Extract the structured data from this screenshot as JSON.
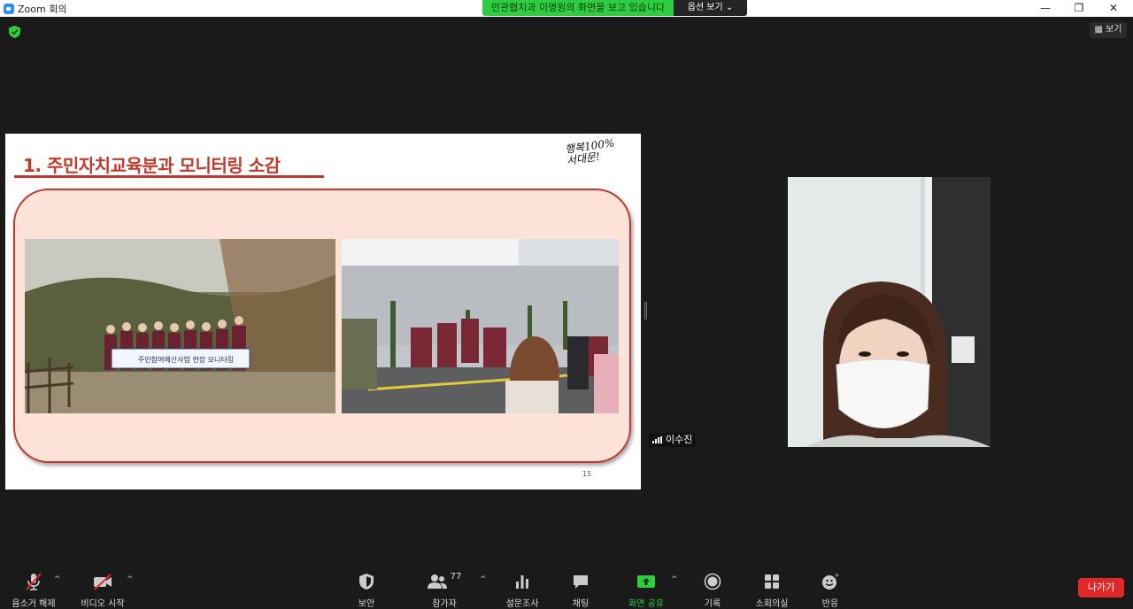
{
  "window": {
    "title": "Zoom 회의",
    "minimize": "—",
    "restore": "❐",
    "close": "✕"
  },
  "share_banner": {
    "text": "민관협치과 이명원의 화면을 보고 있습니다",
    "view_options": "옵션 보기 ⌄"
  },
  "view_button": "보기",
  "slide": {
    "title": "1. 주민자치교육분과 모니터링 소감",
    "logo_text": "행복100%\n서대문!",
    "photo_banner_text": "주민참여예산사업 현장 모니터링",
    "page_number": "15"
  },
  "speaker": {
    "name": "이수진"
  },
  "toolbar": {
    "mute": "음소거 해제",
    "video": "비디오 시작",
    "security": "보안",
    "participants": "참가자",
    "participants_count": "77",
    "polls": "설문조사",
    "chat": "채팅",
    "share_screen": "화면 공유",
    "record": "기록",
    "breakout": "소회의실",
    "reactions": "반응",
    "leave": "나가기"
  },
  "colors": {
    "share_green": "#2ecc40",
    "leave_red": "#e02828",
    "slide_accent": "#c0392b",
    "panel_fill": "#fde3d7"
  }
}
